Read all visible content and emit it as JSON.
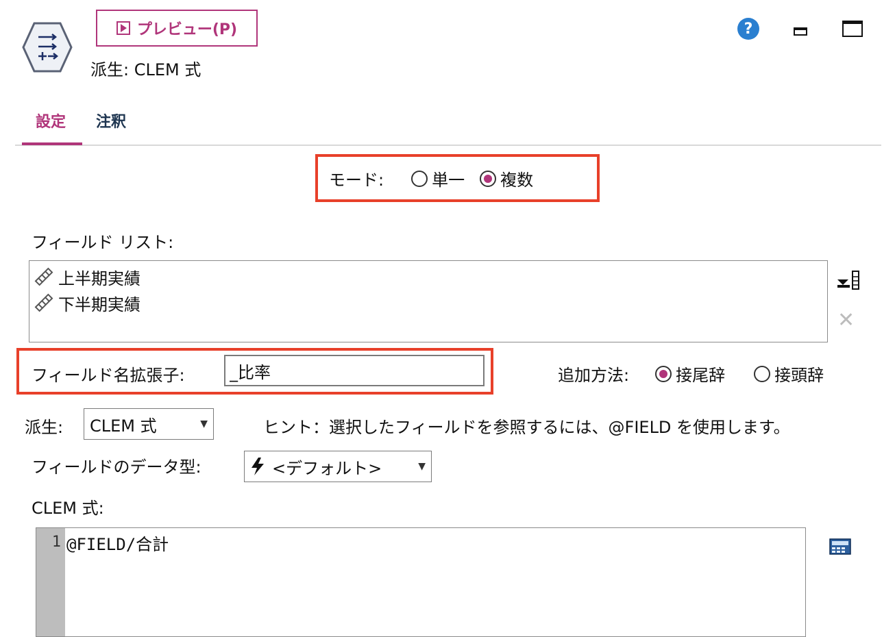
{
  "header": {
    "preview_label": "プレビュー(P)",
    "node_title": "派生: CLEM 式",
    "icons": [
      "derive-node-icon",
      "help-icon",
      "minimize-icon",
      "maximize-icon"
    ]
  },
  "tabs": [
    {
      "label": "設定",
      "active": true
    },
    {
      "label": "注釈",
      "active": false
    }
  ],
  "mode": {
    "label": "モード:",
    "options": [
      {
        "label": "単一",
        "selected": false
      },
      {
        "label": "複数",
        "selected": true
      }
    ]
  },
  "field_list": {
    "label": "フィールド リスト:",
    "items": [
      "上半期実績",
      "下半期実績"
    ]
  },
  "extension": {
    "label": "フィールド名拡張子:",
    "value": "_比率"
  },
  "add_method": {
    "label": "追加方法:",
    "options": [
      {
        "label": "接尾辞",
        "selected": true
      },
      {
        "label": "接頭辞",
        "selected": false
      }
    ]
  },
  "derive": {
    "label": "派生:",
    "selected": "CLEM 式",
    "hint": "ヒント：選択したフィールドを参照するには、@FIELD を使用します。"
  },
  "field_type": {
    "label": "フィールドのデータ型:",
    "selected": "<デフォルト>"
  },
  "clem": {
    "label": "CLEM 式:",
    "line_number": "1",
    "code": "@FIELD/合計"
  },
  "colors": {
    "accent": "#b0357a",
    "highlight_box": "#e8402a",
    "help_blue": "#2a7fd0"
  }
}
